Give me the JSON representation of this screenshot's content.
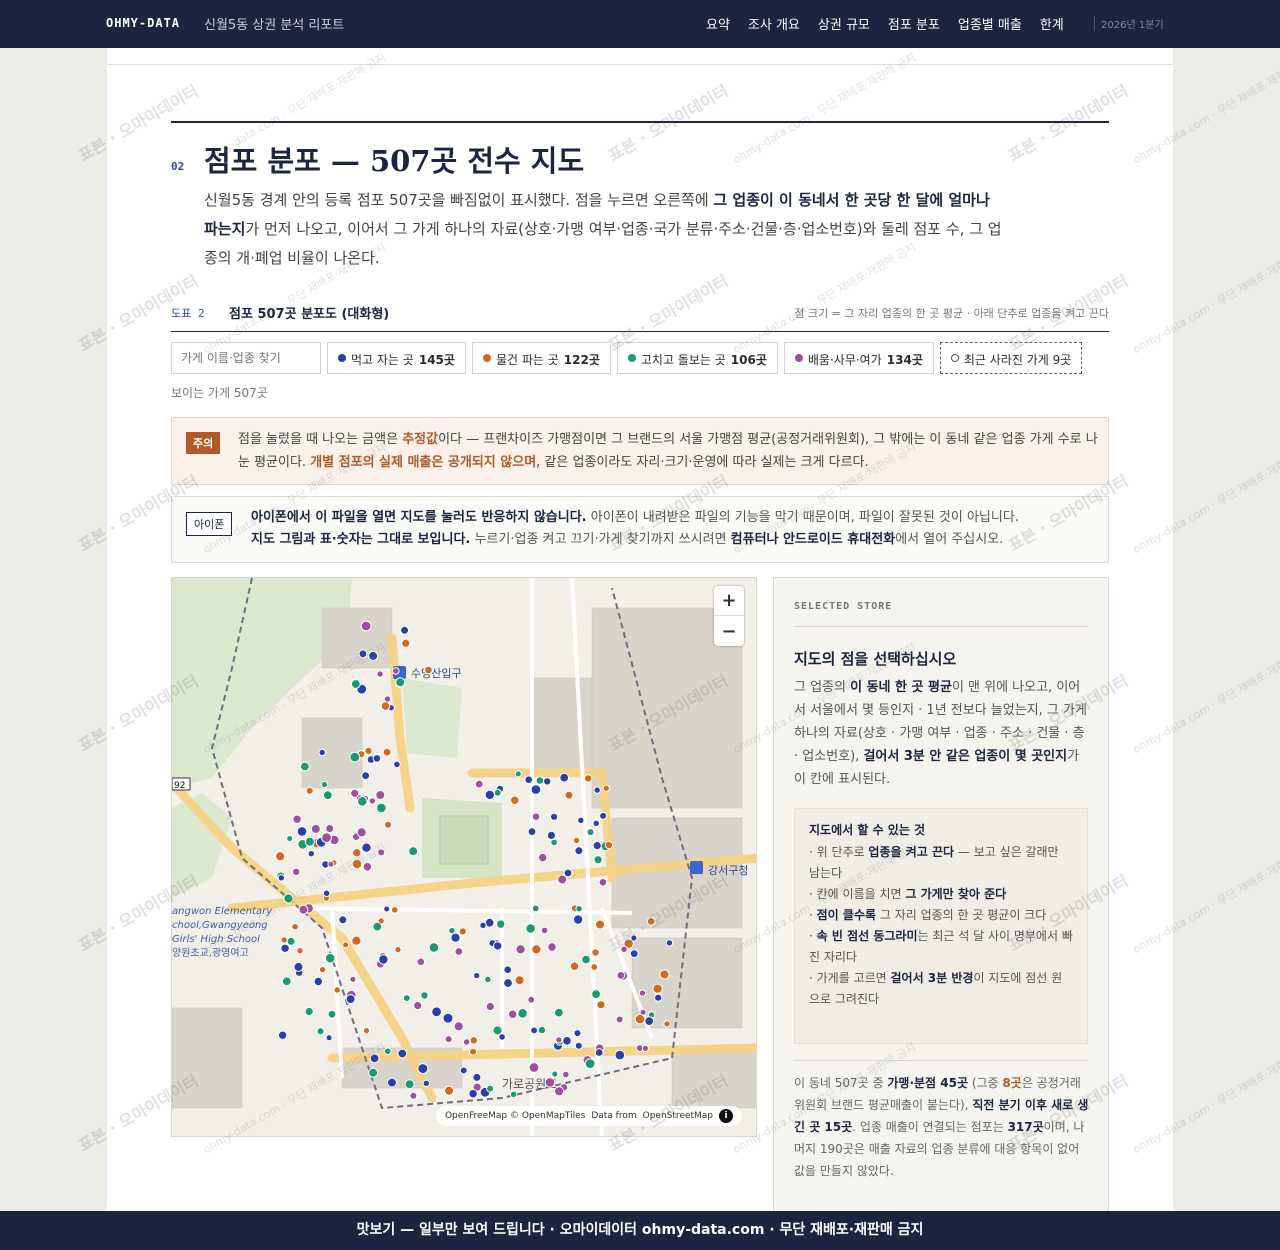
{
  "nav": {
    "brand": "OHMY-DATA",
    "report_title": "신월5동 상권 분석 리포트",
    "links": [
      "요약",
      "조사 개요",
      "상권 규모",
      "점포 분포",
      "업종별 매출",
      "한계"
    ],
    "period": "2026년 1분기"
  },
  "section": {
    "number": "02",
    "title": "점포 분포 — 507곳 전수 지도",
    "desc_1": "신월5동 경계 안의 등록 점포 507곳을 빠짐없이 표시했다. 점을 누르면 오른쪽에 ",
    "desc_b": "그 업종이 이 동네서 한 곳당 한 달에 얼마나 파는지",
    "desc_2": "가 먼저 나오고, 이어서 그 가게 하나의 자료(상호·가맹 여부·업종·국가 분류·주소·건물·층·업소번호)와 둘레 점포 수, 그 업종의 개·폐업 비율이 나온다."
  },
  "figure": {
    "number": "도표 2",
    "title": "점포 507곳 분포도 (대화형)",
    "note": "점 크기 = 그 자리 업종의 한 곳 평균 · 아래 단추로 업종을 켜고 끈다"
  },
  "filters": {
    "search_placeholder": "가게 이름·업종 찾기",
    "chips": [
      {
        "label": "먹고 자는 곳",
        "count": "145곳",
        "color": "#2a3fa8"
      },
      {
        "label": "물건 파는 곳",
        "count": "122곳",
        "color": "#d2691e"
      },
      {
        "label": "고치고 돌보는 곳",
        "count": "106곳",
        "color": "#1a9a72"
      },
      {
        "label": "배움·사무·여가",
        "count": "134곳",
        "color": "#a24ea0"
      }
    ],
    "removed_chip": "최근 사라진 가게 9곳",
    "visible_count": "보이는 가게 507곳"
  },
  "warning": {
    "tag": "주의",
    "t1": "점을 눌렀을 때 나오는 금액은 ",
    "b1": "추정값",
    "t2": "이다 — 프랜차이즈 가맹점이면 그 브랜드의 서울 가맹점 평균(공정거래위원회), 그 밖에는 이 동네 같은 업종 가게 수로 나눈 평균이다. ",
    "b2": "개별 점포의 실제 매출은 공개되지 않으며",
    "t3": ", 같은 업종이라도 자리·크기·운영에 따라 실제는 크게 다르다."
  },
  "ios_notice": {
    "tag": "아이폰",
    "b1": "아이폰에서 이 파일을 열면 지도를 눌러도 반응하지 않습니다.",
    "t1": " 아이폰이 내려받은 파일의 기능을 막기 때문이며, 파일이 잘못된 것이 아닙니다.",
    "b2": "지도 그림과 표·숫자는 그대로 보입니다.",
    "t2": " 누르기·업종 켜고 끄기·가게 찾기까지 쓰시려면 ",
    "b3": "컴퓨터나 안드로이드 휴대전화",
    "t3": "에서 열어 주십시오."
  },
  "map": {
    "zoom_in": "+",
    "zoom_out": "−",
    "attribution_1": "OpenFreeMap © OpenMapTiles",
    "attribution_b": "Data from",
    "attribution_2": "OpenStreetMap",
    "info": "i",
    "labels": {
      "station1": "수명산입구",
      "station2": "강서구청",
      "school1": "angwon Elementary",
      "school2": "chool,Gwangyeong",
      "school3": "Girls' High School",
      "school4": "양원초교,광영여고",
      "road": "가로공원로",
      "route": "92"
    }
  },
  "side": {
    "kicker": "SELECTED STORE",
    "title": "지도의 점을 선택하십시오",
    "d1": "그 업종의 ",
    "db1": "이 동네 한 곳 평균",
    "d2": "이 맨 위에 나오고, 이어서 서울에서 몇 등인지 · 1년 전보다 늘었는지, 그 가게 하나의 자료(상호 · 가맹 여부 · 업종 · 주소 · 건물 · 층 · 업소번호), ",
    "db2": "걸어서 3분 안 같은 업종이 몇 곳인지",
    "d3": "가 이 칸에 표시된다.",
    "box_title": "지도에서 할 수 있는 것",
    "tips": [
      {
        "pre": "· 위 단추로 ",
        "b": "업종을 켜고 끈다",
        "post": " — 보고 싶은 갈래만 남는다"
      },
      {
        "pre": "· 칸에 이름을 치면 ",
        "b": "그 가게만 찾아 준다",
        "post": ""
      },
      {
        "pre": "· ",
        "b": "점이 클수록",
        "post": " 그 자리 업종의 한 곳 평균이 크다"
      },
      {
        "pre": "· ",
        "b": "속 빈 점선 동그라미",
        "post": "는 최근 석 달 사이 명부에서 빠진 자리다"
      },
      {
        "pre": "· 가게를 고르면 ",
        "b": "걸어서 3분 반경",
        "post": "이 지도에 점선 원으로 그려진다"
      }
    ],
    "s1": "이 동네 507곳 중 ",
    "sb1": "가맹·분점 45곳",
    "s2": " (그중 ",
    "so1": "8곳",
    "s3": "은 공정거래위원회 브랜드 평균매출이 붙는다), ",
    "sb2": "직전 분기 이후 새로 생긴 곳 15곳",
    "s4": ". 업종 매출이 연결되는 점포는 ",
    "sb3": "317곳",
    "s5": "이며, 나머지 190곳은 매출 자료의 업종 분류에 대응 항목이 없어 값을 만들지 않았다."
  },
  "watermark": {
    "main": "표본 · 오마이데이터",
    "sub": "ohmy-data.com · 무단 재배포·재판매 금지"
  },
  "footer": "맛보기 — 일부만 보여 드립니다 · 오마이데이터 ohmy-data.com · 무단 재배포·재판매 금지"
}
